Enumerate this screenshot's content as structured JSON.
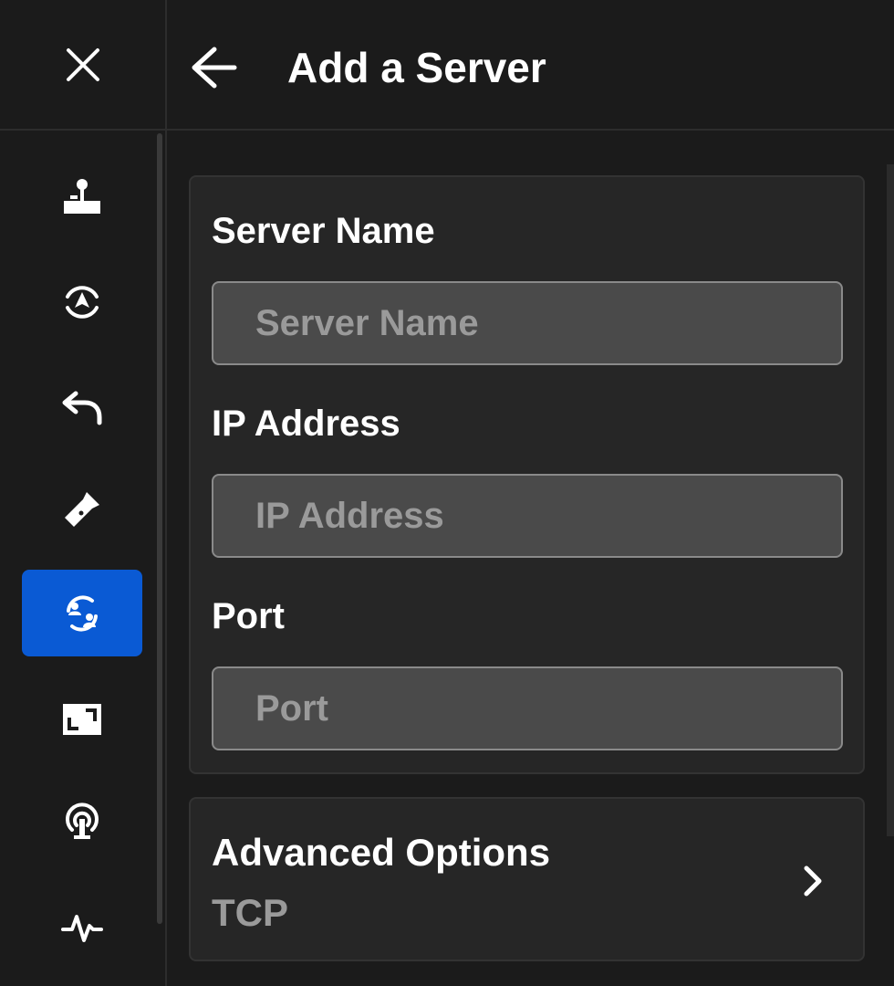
{
  "header": {
    "title": "Add a Server",
    "back_icon": "arrow-left-icon"
  },
  "rail": {
    "close_icon": "close-icon",
    "items": [
      {
        "icon": "joystick-icon",
        "active": false
      },
      {
        "icon": "recenter-icon",
        "active": false
      },
      {
        "icon": "undo-icon",
        "active": false
      },
      {
        "icon": "flashlight-icon",
        "active": false
      },
      {
        "icon": "user-switch-icon",
        "active": true
      },
      {
        "icon": "fullscreen-icon",
        "active": false
      },
      {
        "icon": "broadcast-icon",
        "active": false
      },
      {
        "icon": "activity-icon",
        "active": false
      }
    ],
    "active_color": "#0a5ad4"
  },
  "form": {
    "server_name": {
      "label": "Server Name",
      "placeholder": "Server Name",
      "value": ""
    },
    "ip_address": {
      "label": "IP Address",
      "placeholder": "IP Address",
      "value": ""
    },
    "port": {
      "label": "Port",
      "placeholder": "Port",
      "value": ""
    }
  },
  "advanced": {
    "title": "Advanced Options",
    "value": "TCP",
    "chevron_icon": "chevron-right-icon"
  }
}
